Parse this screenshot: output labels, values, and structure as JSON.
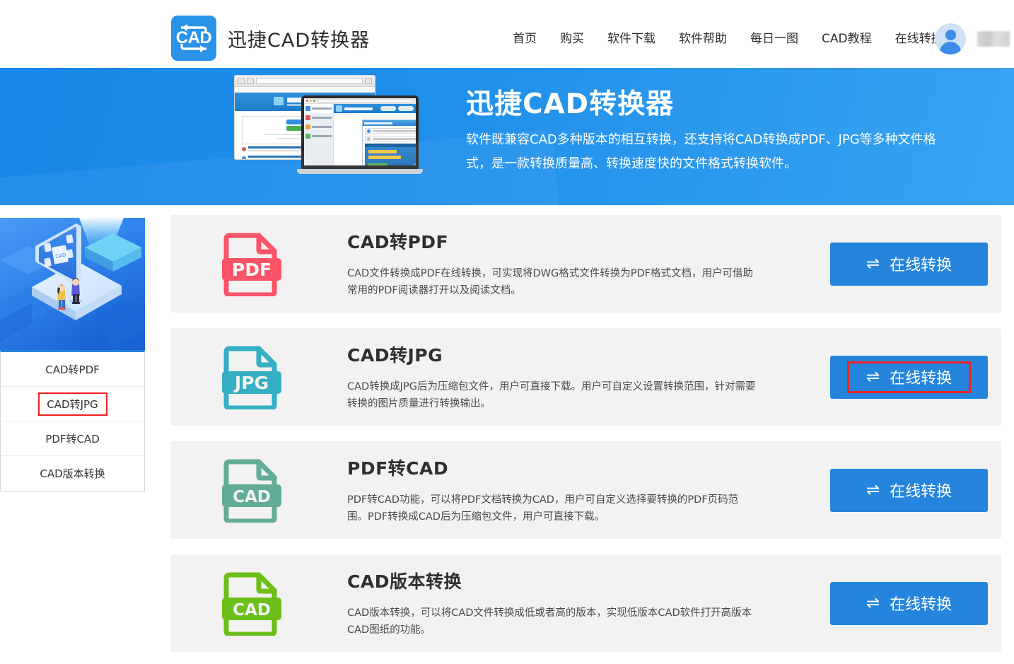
{
  "header": {
    "brand": {
      "logo_text": "CAD",
      "logo_icon": "cad-swap-logo-icon",
      "title": "迅捷CAD转换器"
    },
    "nav": [
      {
        "label": "首页",
        "name": "nav-home"
      },
      {
        "label": "购买",
        "name": "nav-purchase"
      },
      {
        "label": "软件下载",
        "name": "nav-download"
      },
      {
        "label": "软件帮助",
        "name": "nav-help"
      },
      {
        "label": "每日一图",
        "name": "nav-daily-image"
      },
      {
        "label": "CAD教程",
        "name": "nav-tutorial"
      },
      {
        "label": "在线转换",
        "name": "nav-online-convert"
      }
    ],
    "user": {
      "avatar_icon": "user-avatar-icon",
      "username": ""
    }
  },
  "banner": {
    "title": "迅捷CAD转换器",
    "subtitle": "软件既兼容CAD多种版本的相互转换，还支持将CAD转换成PDF、JPG等多种文件格式，是一款转换质量高、转换速度快的文件格式转换软件。",
    "artwork_name": "browser-and-laptop-illustration",
    "bg_color": "#2090ea"
  },
  "sidebar": {
    "illustration_name": "isometric-cad-platform-illustration",
    "items": [
      {
        "label": "CAD转PDF",
        "name": "sidebar-item-cad-to-pdf",
        "highlighted": false
      },
      {
        "label": "CAD转JPG",
        "name": "sidebar-item-cad-to-jpg",
        "highlighted": true
      },
      {
        "label": "PDF转CAD",
        "name": "sidebar-item-pdf-to-cad",
        "highlighted": false
      },
      {
        "label": "CAD版本转换",
        "name": "sidebar-item-cad-version-convert",
        "highlighted": false
      }
    ]
  },
  "cards": [
    {
      "title": "CAD转PDF",
      "desc": "CAD文件转换成PDF在线转换，可实现将DWG格式文件转换为PDF格式文档，用户可借助常用的PDF阅读器打开以及阅读文档。",
      "icon_label": "PDF",
      "icon_name": "pdf-file-icon",
      "icon_color": "#fb5468",
      "button_label": "在线转换",
      "button_icon": "swap-arrows-icon",
      "highlighted": false
    },
    {
      "title": "CAD转JPG",
      "desc": "CAD转换成JPG后为压缩包文件，用户可直接下载。用户可自定义设置转换范围，针对需要转换的图片质量进行转换输出。",
      "icon_label": "JPG",
      "icon_name": "jpg-file-icon",
      "icon_color": "#34afc4",
      "button_label": "在线转换",
      "button_icon": "swap-arrows-icon",
      "highlighted": true
    },
    {
      "title": "PDF转CAD",
      "desc": "PDF转CAD功能，可以将PDF文档转换为CAD，用户可自定义选择要转换的PDF页码范围。PDF转换成CAD后为压缩包文件，用户可直接下载。",
      "icon_label": "CAD",
      "icon_name": "cad-file-icon-teal",
      "icon_color": "#63ac97",
      "button_label": "在线转换",
      "button_icon": "swap-arrows-icon",
      "highlighted": false
    },
    {
      "title": "CAD版本转换",
      "desc": "CAD版本转换，可以将CAD文件转换成低或者高的版本，实现低版本CAD软件打开高版本CAD图纸的功能。",
      "icon_label": "CAD",
      "icon_name": "cad-file-icon-green",
      "icon_color": "#6cbe18",
      "button_label": "在线转换",
      "button_icon": "swap-arrows-icon",
      "highlighted": false
    }
  ],
  "theme": {
    "accent": "#2585dc",
    "banner_blue": "#2090ea",
    "highlight_red": "#f02020",
    "card_bg": "#f2f2f2"
  }
}
